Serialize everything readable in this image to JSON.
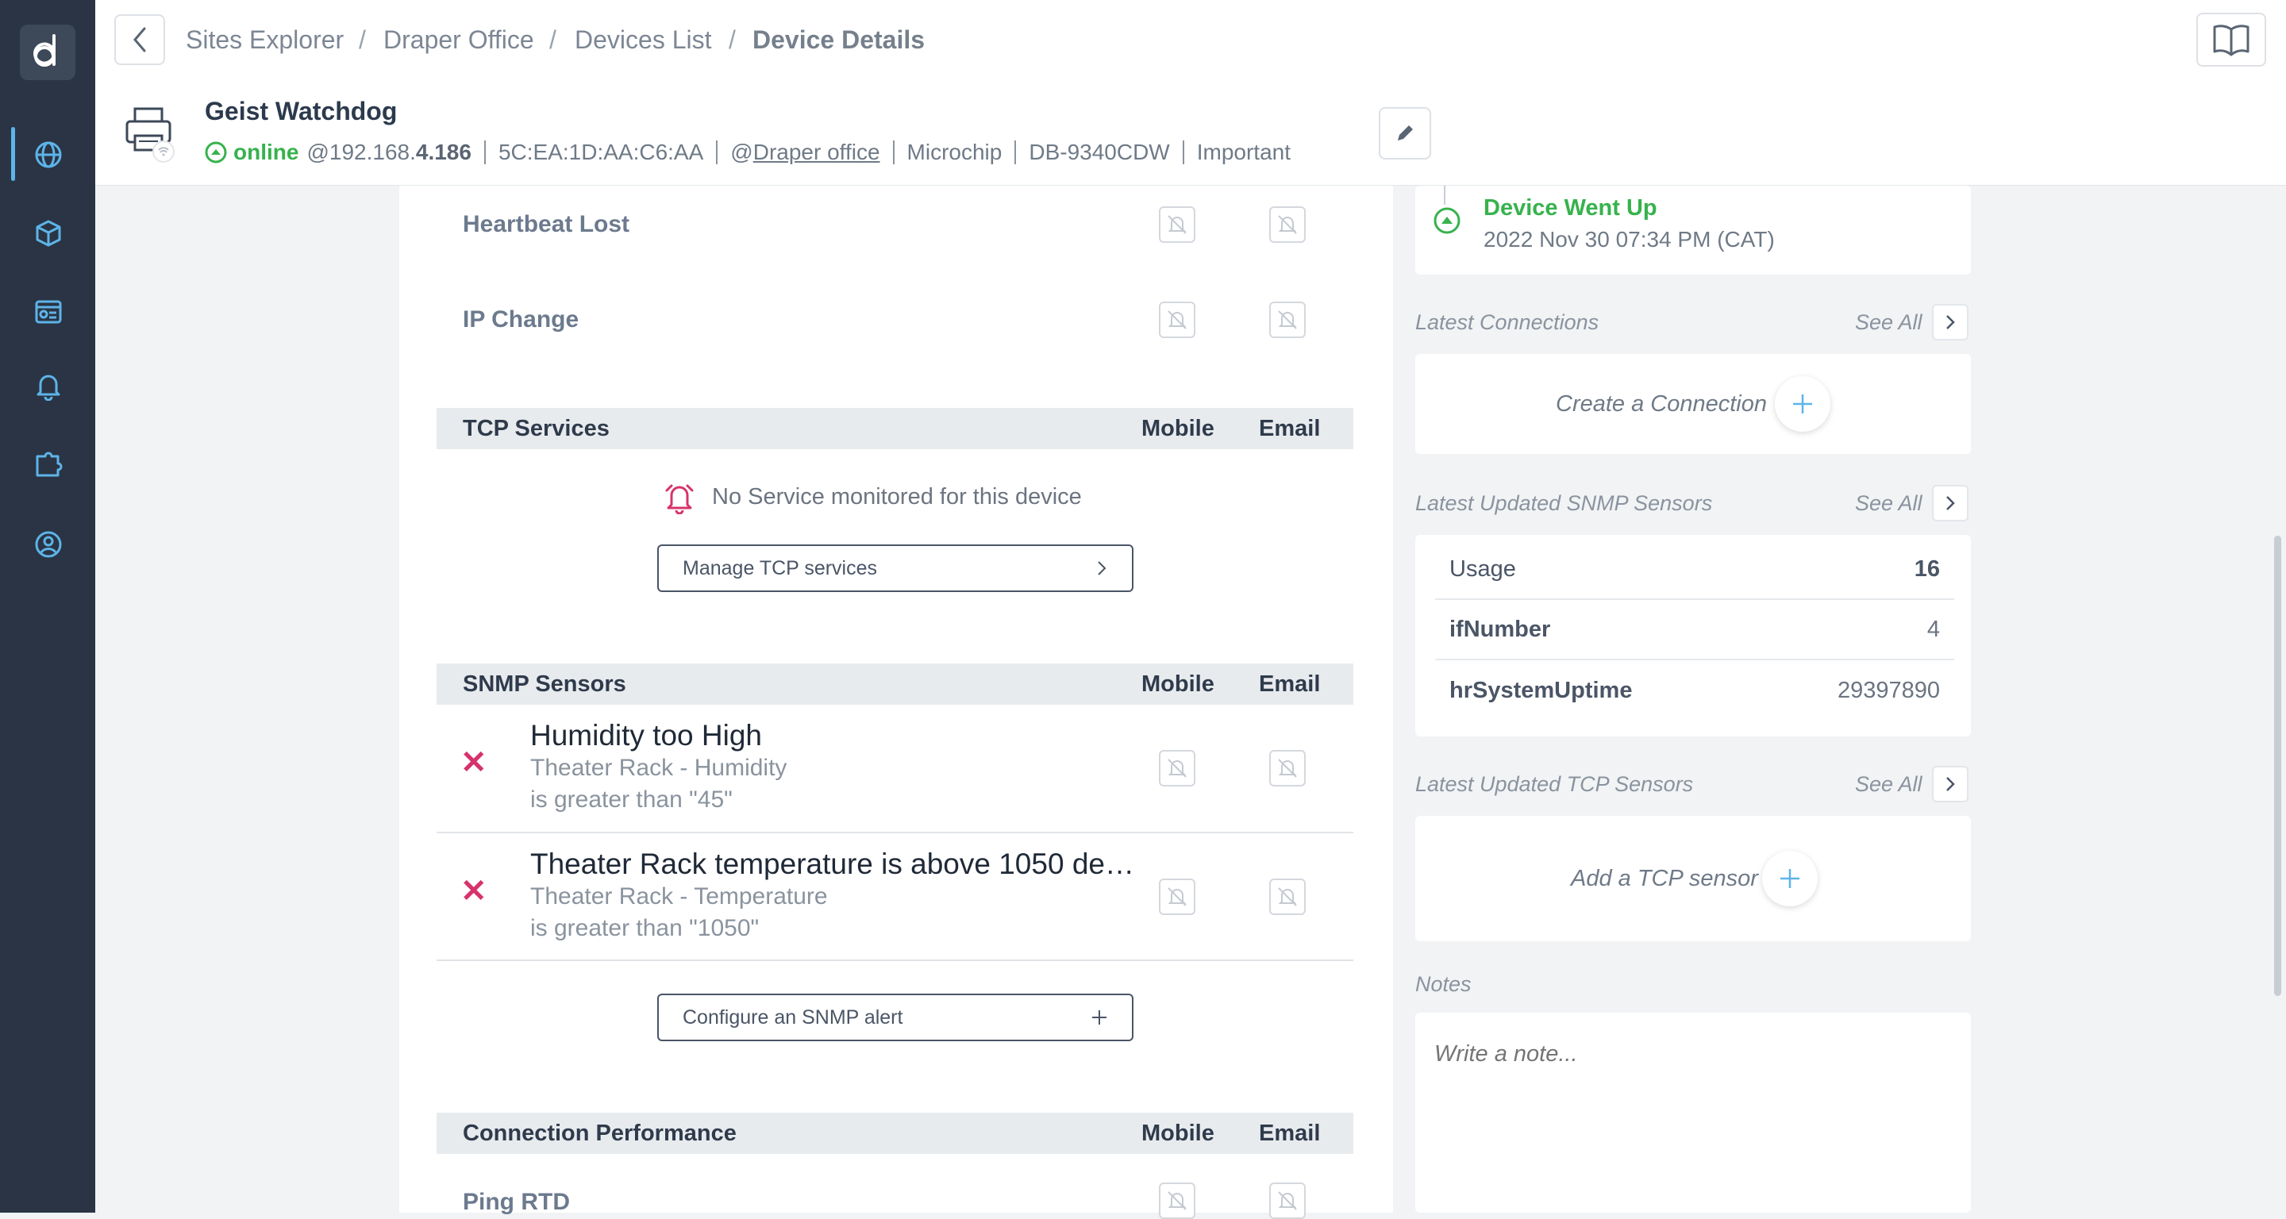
{
  "sidebar": {
    "logo": "d",
    "items": [
      {
        "icon": "globe-icon",
        "active": true
      },
      {
        "icon": "cubes-icon",
        "active": false
      },
      {
        "icon": "dashboard-icon",
        "active": false
      },
      {
        "icon": "bell-icon",
        "active": false
      },
      {
        "icon": "puzzle-icon",
        "active": false
      },
      {
        "icon": "user-circle-icon",
        "active": false
      }
    ]
  },
  "breadcrumb": {
    "items": [
      "Sites Explorer",
      "Draper Office",
      "Devices List"
    ],
    "current": "Device Details",
    "separator": "/"
  },
  "device": {
    "name": "Geist Watchdog",
    "status": "online",
    "ip_prefix": "@192.168.",
    "ip_suffix": "4.186",
    "mac": "5C:EA:1D:AA:C6:AA",
    "site_prefix": "@",
    "site": "Draper office",
    "vendor": "Microchip",
    "model": "DB-9340CDW",
    "importance": "Important"
  },
  "events": {
    "rows": [
      "Heartbeat Lost",
      "IP Change"
    ]
  },
  "tcp_services": {
    "title": "TCP Services",
    "col_mobile": "Mobile",
    "col_email": "Email",
    "empty_text": "No Service monitored for this device",
    "manage_button": "Manage TCP services"
  },
  "snmp_sensors": {
    "title": "SNMP Sensors",
    "col_mobile": "Mobile",
    "col_email": "Email",
    "alerts": [
      {
        "title": "Humidity too High",
        "sensor": "Theater Rack - Humidity",
        "condition": "is greater than \"45\""
      },
      {
        "title": "Theater Rack temperature is above 1050 de…",
        "sensor": "Theater Rack - Temperature",
        "condition": "is greater than \"1050\""
      }
    ],
    "configure_button": "Configure an SNMP alert"
  },
  "connection_performance": {
    "title": "Connection Performance",
    "col_mobile": "Mobile",
    "col_email": "Email",
    "rows": [
      "Ping RTD"
    ]
  },
  "right": {
    "latest_event": {
      "title": "Device Went Up",
      "time": "2022 Nov 30 07:34 PM (CAT)"
    },
    "connections": {
      "label": "Latest Connections",
      "see_all": "See All",
      "create": "Create a Connection"
    },
    "snmp": {
      "label": "Latest Updated SNMP Sensors",
      "see_all": "See All",
      "rows": [
        {
          "name": "Usage",
          "value": "16"
        },
        {
          "name": "ifNumber",
          "value": "4"
        },
        {
          "name": "hrSystemUptime",
          "value": "29397890"
        }
      ]
    },
    "tcp": {
      "label": "Latest Updated TCP Sensors",
      "see_all": "See All",
      "add": "Add a TCP sensor"
    },
    "notes": {
      "label": "Notes",
      "placeholder": "Write a note..."
    }
  },
  "colors": {
    "sidebar_bg": "#2a3444",
    "accent_green": "#37b24d",
    "alert_red": "#d6336c",
    "link_blue": "#5db4e8"
  }
}
